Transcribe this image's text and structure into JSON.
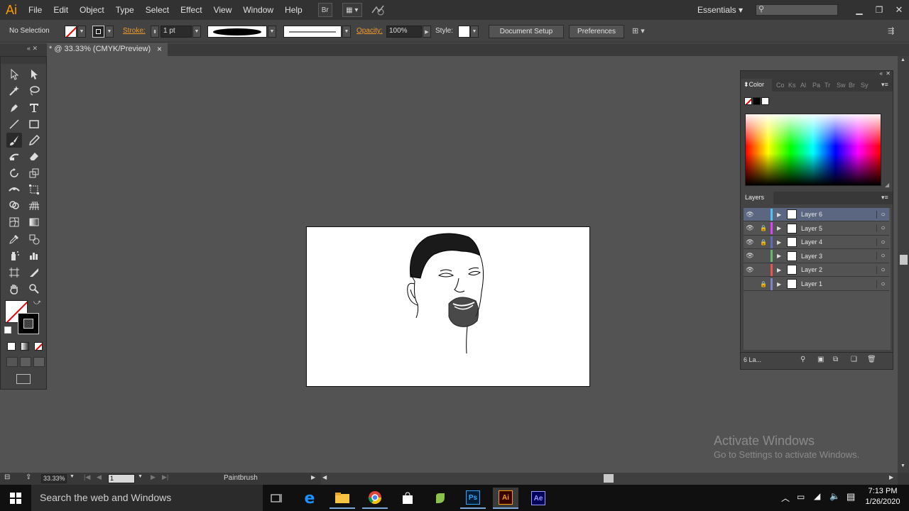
{
  "app": {
    "logo": "Ai",
    "menu": [
      "File",
      "Edit",
      "Object",
      "Type",
      "Select",
      "Effect",
      "View",
      "Window",
      "Help"
    ],
    "bridge_label": "Br",
    "workspace": "Essentials",
    "search_placeholder": ""
  },
  "control_bar": {
    "selection": "No Selection",
    "stroke_label": "Stroke:",
    "stroke_weight": "1 pt",
    "opacity_label": "Opacity:",
    "opacity_value": "100%",
    "style_label": "Style:",
    "document_setup": "Document Setup",
    "preferences": "Preferences"
  },
  "document_tab": {
    "title": "* @ 33.33% (CMYK/Preview)",
    "close": "×"
  },
  "tools": {
    "icons": [
      "selection-tool-icon",
      "direct-selection-tool-icon",
      "magic-wand-tool-icon",
      "lasso-tool-icon",
      "pen-tool-icon",
      "type-tool-icon",
      "line-tool-icon",
      "rectangle-tool-icon",
      "paintbrush-tool-icon",
      "pencil-tool-icon",
      "shaper-tool-icon",
      "eraser-tool-icon",
      "rotate-tool-icon",
      "scale-tool-icon",
      "width-tool-icon",
      "free-transform-tool-icon",
      "shape-builder-tool-icon",
      "perspective-grid-tool-icon",
      "mesh-tool-icon",
      "gradient-tool-icon",
      "eyedropper-tool-icon",
      "blend-tool-icon",
      "symbol-sprayer-tool-icon",
      "column-graph-tool-icon",
      "artboard-tool-icon",
      "slice-tool-icon",
      "hand-tool-icon",
      "zoom-tool-icon"
    ],
    "active": "paintbrush-tool-icon"
  },
  "color_panel": {
    "title": "Color",
    "tabs": [
      "Co",
      "Ks",
      "Al",
      "Pa",
      "Tr",
      "Sw",
      "Br",
      "Sy"
    ]
  },
  "layers_panel": {
    "title": "Layers",
    "footer": "6 La...",
    "layers": [
      {
        "name": "Layer 6",
        "visible": true,
        "locked": false,
        "color": "#4fc3f7",
        "selected": true
      },
      {
        "name": "Layer 5",
        "visible": true,
        "locked": true,
        "color": "#e040fb",
        "selected": false
      },
      {
        "name": "Layer 4",
        "visible": true,
        "locked": true,
        "color": "#5c6bc0",
        "selected": false
      },
      {
        "name": "Layer 3",
        "visible": true,
        "locked": false,
        "color": "#66bb6a",
        "selected": false
      },
      {
        "name": "Layer 2",
        "visible": true,
        "locked": false,
        "color": "#ef5350",
        "selected": false
      },
      {
        "name": "Layer 1",
        "visible": false,
        "locked": true,
        "color": "#7986cb",
        "selected": false
      }
    ]
  },
  "status_bar": {
    "zoom": "33.33%",
    "artboard_number": "1",
    "tool_name": "Paintbrush"
  },
  "watermark": {
    "title": "Activate Windows",
    "subtitle": "Go to Settings to activate Windows."
  },
  "taskbar": {
    "search_text": "Search the web and Windows",
    "time": "7:13 PM",
    "date": "1/26/2020",
    "apps": [
      "task-view-icon",
      "edge-icon",
      "file-explorer-icon",
      "chrome-icon",
      "store-icon",
      "green-app-icon",
      "photoshop-icon",
      "illustrator-icon",
      "after-effects-icon"
    ],
    "ps_label": "Ps",
    "ai_label": "Ai",
    "ae_label": "Ae"
  },
  "colors": {
    "accent_orange": "#ff9a00",
    "selected_layer": "#5b6780",
    "workspace_bg": "#535353"
  }
}
